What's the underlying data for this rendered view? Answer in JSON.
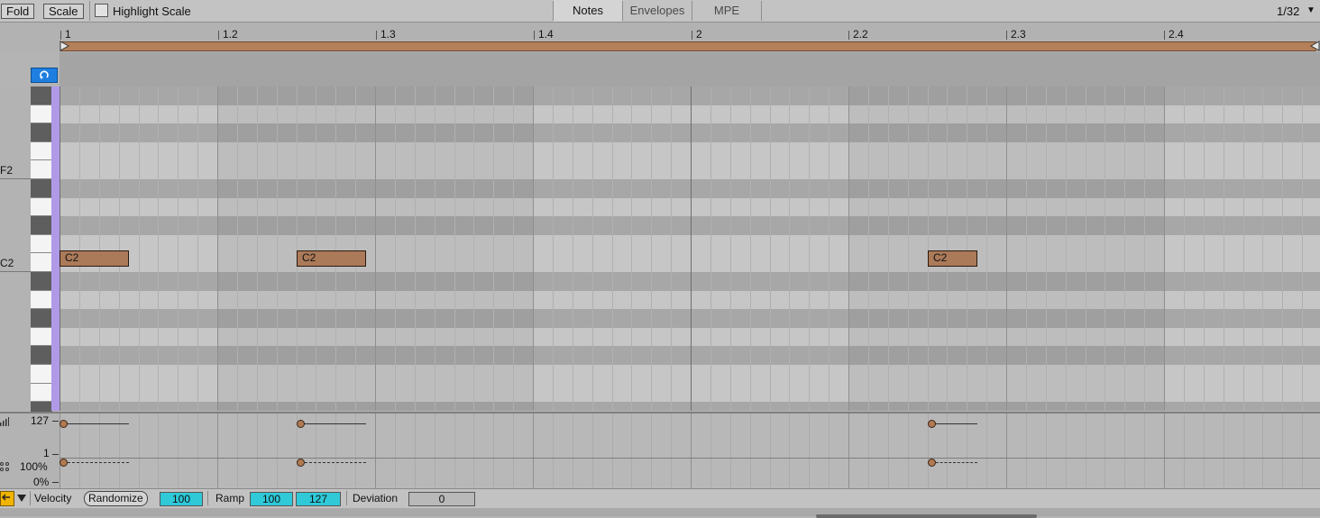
{
  "toolbar": {
    "fold_label": "Fold",
    "scale_label": "Scale",
    "highlight_scale_label": "Highlight Scale",
    "tabs": [
      "Notes",
      "Envelopes",
      "MPE"
    ],
    "grid_value": "1/32",
    "grid_dropdown_icon": "▼"
  },
  "ruler": {
    "markers": [
      "1",
      "1.2",
      "1.3",
      "1.4",
      "2",
      "2.2",
      "2.3",
      "2.4"
    ]
  },
  "loop_icon": "loop-icon",
  "piano": {
    "labels": [
      "F2",
      "C2"
    ]
  },
  "notes": [
    {
      "label": "C2",
      "pitch": "C2",
      "start_beats": 0.0,
      "duration_beats": 0.4375
    },
    {
      "label": "C2",
      "pitch": "C2",
      "start_beats": 1.5,
      "duration_beats": 0.4375
    },
    {
      "label": "C2",
      "pitch": "C2",
      "start_beats": 5.5,
      "duration_beats": 0.3125
    }
  ],
  "velocity_lane": {
    "max_label": "127",
    "min_label": "1",
    "chance_max_label": "100%",
    "chance_min_label": "0%",
    "velocities": [
      127,
      127,
      127
    ],
    "chances": [
      100,
      100,
      100
    ]
  },
  "bottombar": {
    "velocity_label": "Velocity",
    "randomize_label": "Randomize",
    "randomize_value": "100",
    "ramp_label": "Ramp",
    "ramp_start": "100",
    "ramp_end": "127",
    "deviation_label": "Deviation",
    "deviation_value": "0"
  },
  "colors": {
    "note": "#ab7a59",
    "accent": "#1f7fe0",
    "cyan_field": "#2fc9d8",
    "fold_lane": "#b09ae8"
  }
}
